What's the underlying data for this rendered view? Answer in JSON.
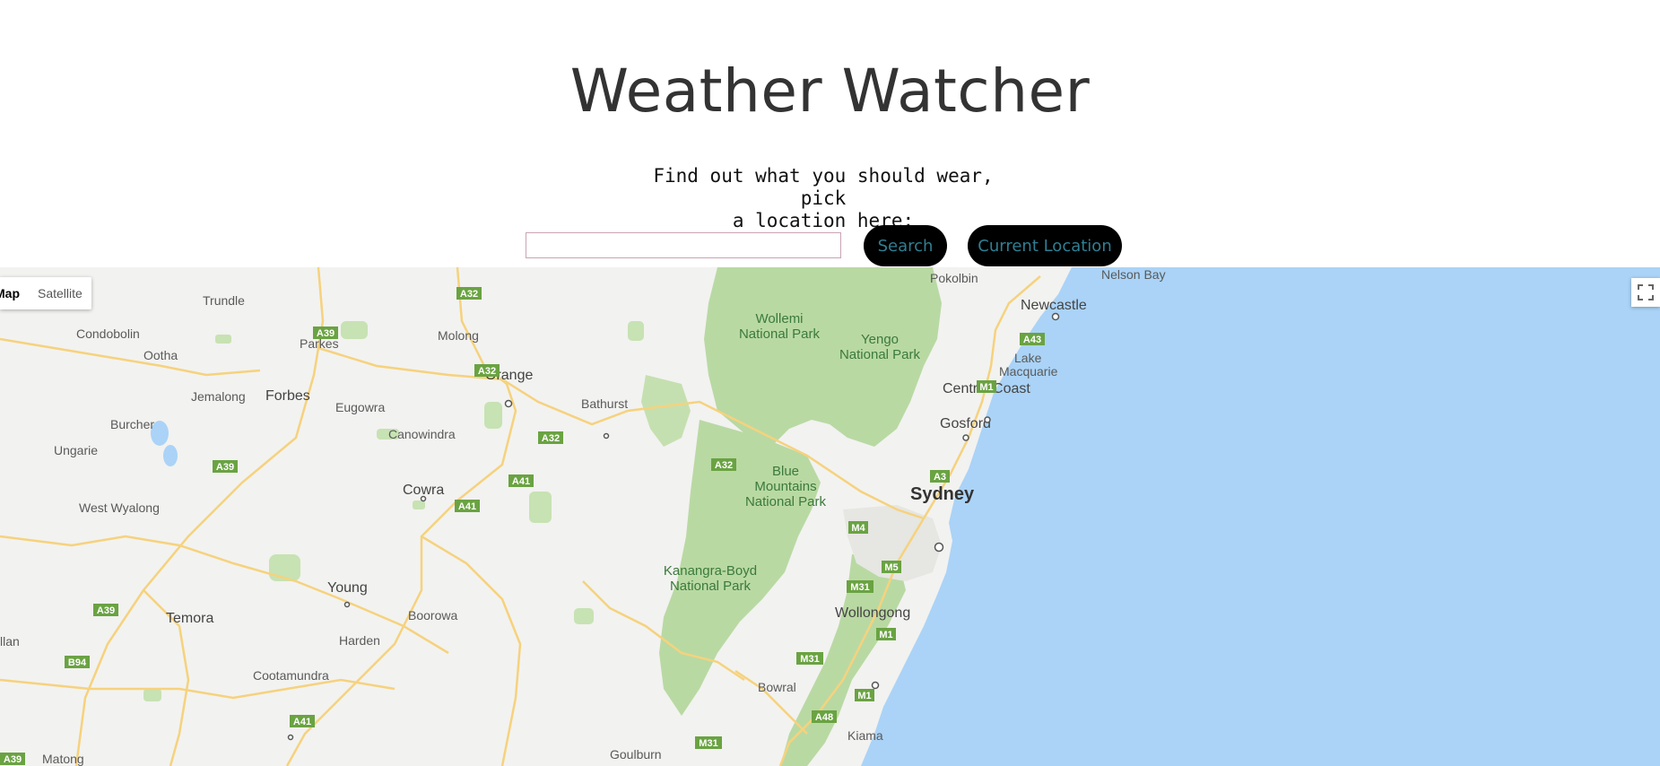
{
  "header": {
    "title": "Weather Watcher",
    "tagline_line1": "Find out what you should wear, pick",
    "tagline_line2": "a location here:"
  },
  "search": {
    "value": "",
    "placeholder": "",
    "search_label": "Search",
    "current_location_label": "Current Location"
  },
  "map": {
    "type_options": [
      "Map",
      "Satellite"
    ],
    "selected_type": "Map",
    "fullscreen_icon": "fullscreen-icon",
    "colors": {
      "land": "#f2f2f0",
      "park": "#b9d9a3",
      "water": "#aad3f7",
      "road": "#f6d27d",
      "shield": "#6aa342"
    },
    "places": [
      {
        "name": "Pokolbin"
      },
      {
        "name": "Nelson Bay"
      },
      {
        "name": "Newcastle"
      },
      {
        "name": "Lake"
      },
      {
        "name": "Macquarie"
      },
      {
        "name": "Trundle"
      },
      {
        "name": "Condobolin"
      },
      {
        "name": "Ootha"
      },
      {
        "name": "Parkes"
      },
      {
        "name": "Molong"
      },
      {
        "name": "Orange"
      },
      {
        "name": "Jemalong"
      },
      {
        "name": "Forbes"
      },
      {
        "name": "Eugowra"
      },
      {
        "name": "Bathurst"
      },
      {
        "name": "Burcher"
      },
      {
        "name": "Canowindra"
      },
      {
        "name": "Ungarie"
      },
      {
        "name": "Cowra"
      },
      {
        "name": "West Wyalong"
      },
      {
        "name": "Central Coast"
      },
      {
        "name": "Gosford"
      },
      {
        "name": "Sydney"
      },
      {
        "name": "Young"
      },
      {
        "name": "Boorowa"
      },
      {
        "name": "Temora"
      },
      {
        "name": "Harden"
      },
      {
        "name": "Cootamundra"
      },
      {
        "name": "Wollongong"
      },
      {
        "name": "Bowral"
      },
      {
        "name": "Kiama"
      },
      {
        "name": "Goulburn"
      },
      {
        "name": "Matong"
      },
      {
        "name": "llan"
      }
    ],
    "parks": [
      {
        "line1": "Wollemi",
        "line2": "National Park"
      },
      {
        "line1": "Yengo",
        "line2": "National Park"
      },
      {
        "line1": "Blue",
        "line2": "Mountains",
        "line3": "National Park"
      },
      {
        "line1": "Kanangra-Boyd",
        "line2": "National Park"
      }
    ],
    "road_shields": [
      "A32",
      "A39",
      "A32",
      "A32",
      "A32",
      "A39",
      "A41",
      "A41",
      "A39",
      "B94",
      "A41",
      "A39",
      "M1",
      "A43",
      "A3",
      "M4",
      "M5",
      "M31",
      "M1",
      "M31",
      "M1",
      "A48",
      "M31"
    ]
  }
}
